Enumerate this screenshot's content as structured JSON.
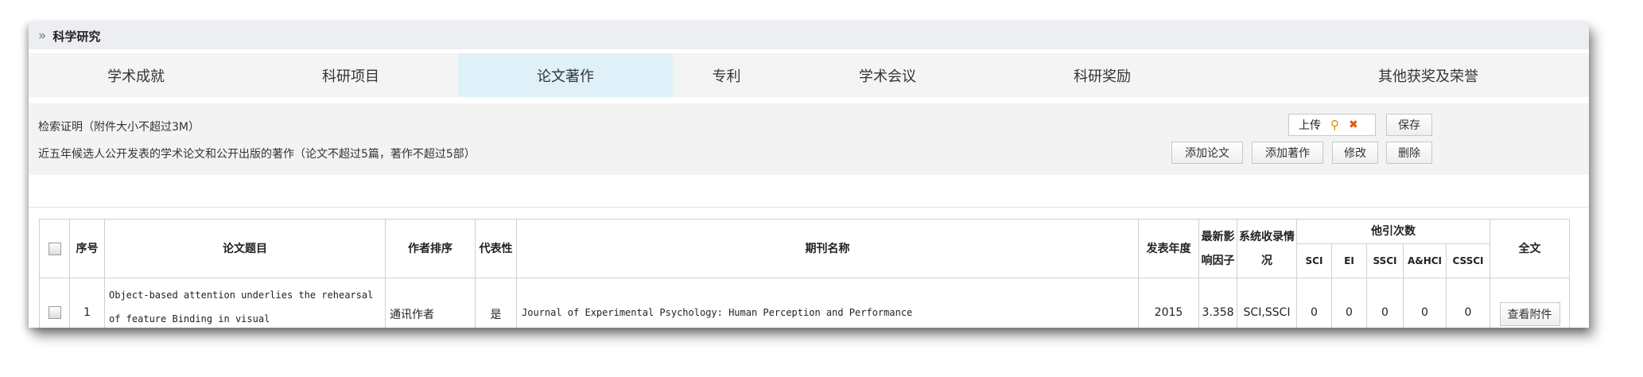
{
  "section": {
    "title": "科学研究"
  },
  "tabs": [
    {
      "label": "学术成就",
      "active": false
    },
    {
      "label": "科研项目",
      "active": false
    },
    {
      "label": "论文著作",
      "active": true
    },
    {
      "label": "专利",
      "active": false
    },
    {
      "label": "学术会议",
      "active": false
    },
    {
      "label": "科研奖励",
      "active": false
    },
    {
      "label": "其他获奖及荣誉",
      "active": false
    }
  ],
  "info": {
    "retrieval_label": "检索证明（附件大小不超过3M）",
    "publications_label": "近五年候选人公开发表的学术论文和公开出版的著作（论文不超过5篇，著作不超过5部）",
    "upload_label": "上传",
    "upload_search_icon": "search-icon",
    "upload_clear_icon": "close-icon",
    "save_label": "保存",
    "add_paper_label": "添加论文",
    "add_book_label": "添加著作",
    "edit_label": "修改",
    "delete_label": "删除"
  },
  "table": {
    "headers": {
      "index": "序号",
      "title": "论文题目",
      "author_order": "作者排序",
      "representative": "代表性",
      "journal": "期刊名称",
      "year": "发表年度",
      "impact_factor": "最新影响因子",
      "indexing": "系统收录情况",
      "citations": "他引次数",
      "sci": "SCI",
      "ei": "EI",
      "ssci": "SSCI",
      "ahci": "A&HCI",
      "cssci": "CSSCI",
      "fulltext": "全文"
    },
    "rows": [
      {
        "index": "1",
        "title": "Object-based attention underlies the rehearsal of feature Binding in visual",
        "author_order": "通讯作者",
        "representative": "是",
        "journal": "Journal of Experimental Psychology: Human Perception and Performance",
        "year": "2015",
        "impact_factor": "3.358",
        "indexing": "SCI,SSCI",
        "sci": "0",
        "ei": "0",
        "ssci": "0",
        "ahci": "0",
        "cssci": "0",
        "fulltext_button": "查看附件"
      }
    ]
  },
  "colors": {
    "active_tab_bg": "#dff0f9",
    "header_bg": "#eceef2",
    "upload_icon_color": "#e08a00"
  }
}
